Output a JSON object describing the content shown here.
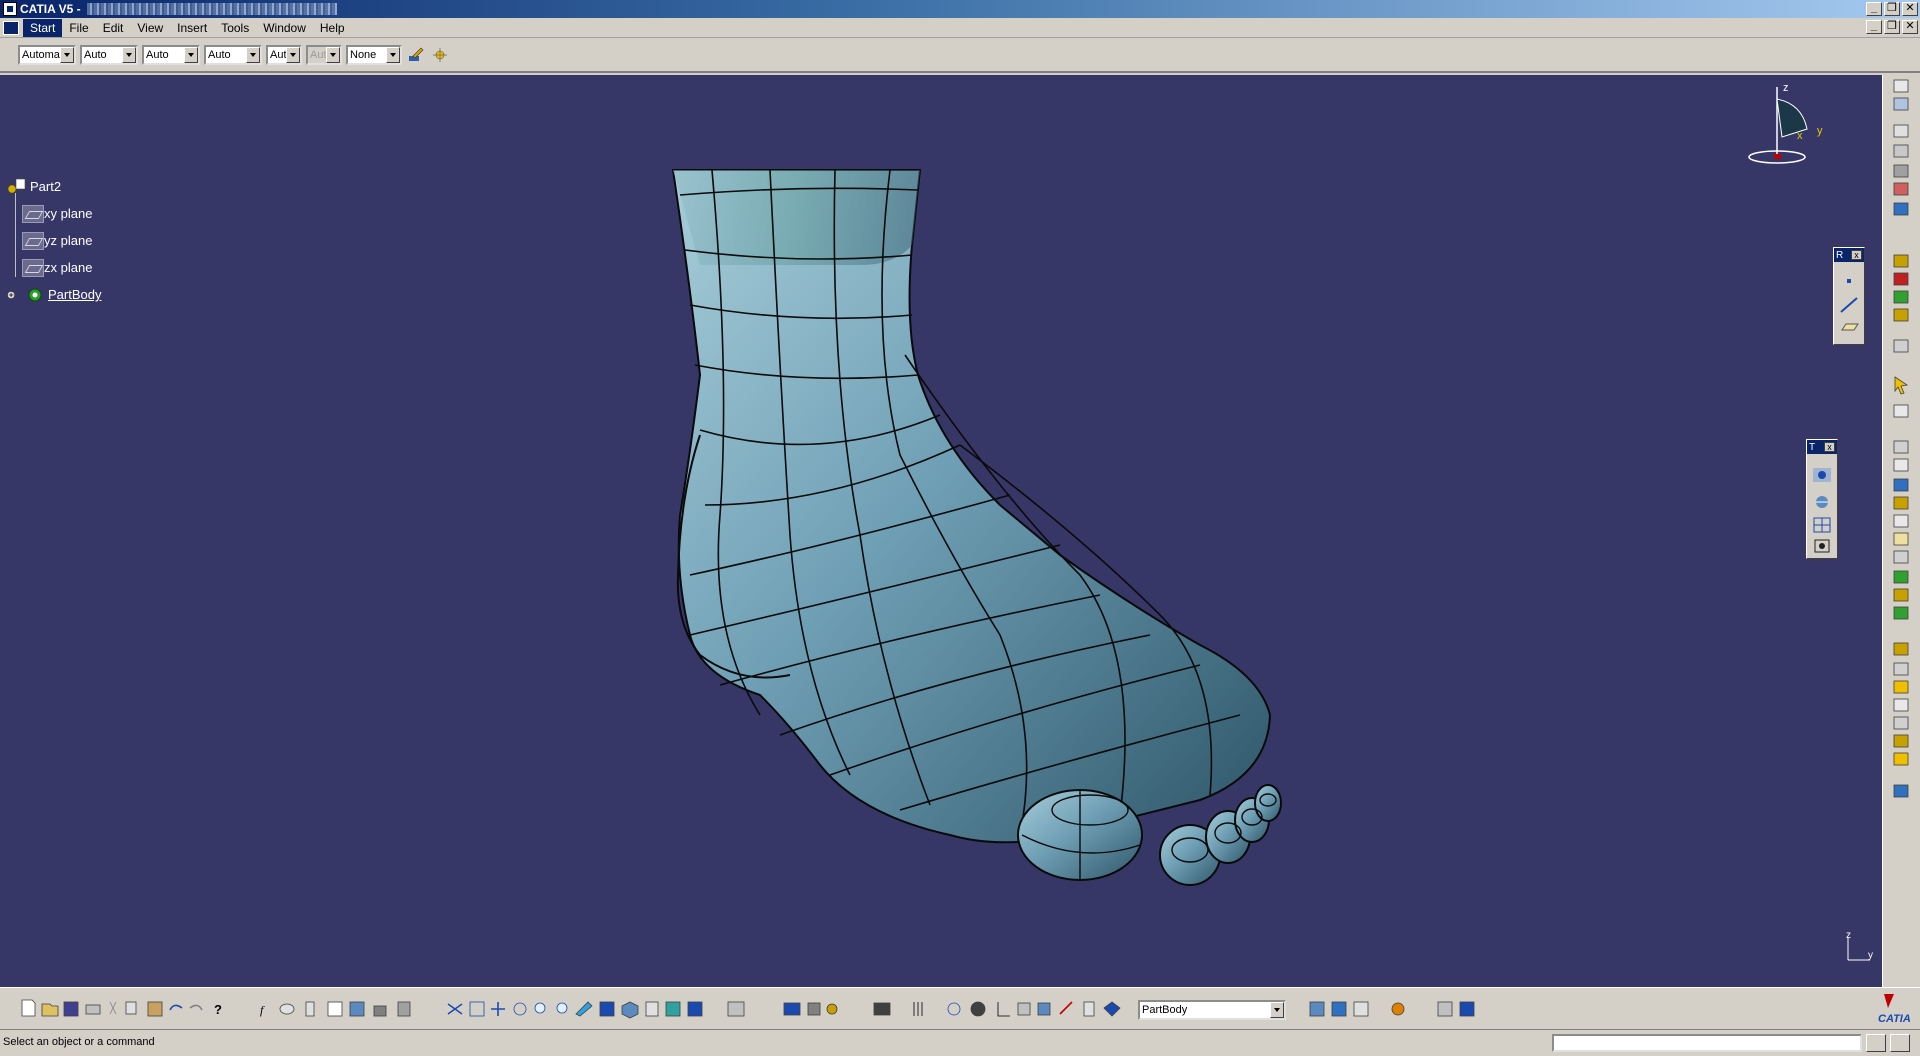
{
  "window": {
    "title": "CATIA V5 -"
  },
  "menu": {
    "items": [
      "Start",
      "File",
      "Edit",
      "View",
      "Insert",
      "Tools",
      "Window",
      "Help"
    ]
  },
  "graphic_properties_toolbar": {
    "fill_color": "Automa",
    "transparency": "Auto",
    "line_thickness": "Auto",
    "line_type": "Auto",
    "point_type": "Aut",
    "disabled_field": "Aut",
    "layer": "None"
  },
  "tree": {
    "root": "Part2",
    "children": [
      "xy plane",
      "yz plane",
      "zx plane"
    ],
    "body": "PartBody"
  },
  "compass": {
    "axis_z": "z",
    "axis_y": "y",
    "axis_x": "x"
  },
  "axis_triad": {
    "z": "z",
    "y": "y"
  },
  "floating_toolbars": {
    "reference_title": "R",
    "tools_title": "T"
  },
  "bottom_toolbar": {
    "current_body": "PartBody"
  },
  "status": {
    "prompt": "Select an object or a command"
  },
  "brand": {
    "name": "CATIA"
  },
  "colors": {
    "viewport_bg": "#363766",
    "model": "#6f9fb5",
    "window_chrome": "#d4d0c8",
    "title_bar": "#0a246a"
  },
  "icons": [
    "new-icon",
    "open-icon",
    "save-icon",
    "print-icon",
    "cut-icon",
    "copy-icon",
    "paste-icon",
    "undo-icon",
    "redo-icon",
    "whats-this-icon",
    "formula-icon",
    "fly-mode-icon",
    "fit-all-icon",
    "pan-icon",
    "rotate-icon",
    "zoom-in-icon",
    "zoom-out-icon",
    "normal-view-icon",
    "multi-view-icon",
    "iso-view-icon",
    "shading-icon",
    "hide-show-icon",
    "swap-space-icon"
  ]
}
